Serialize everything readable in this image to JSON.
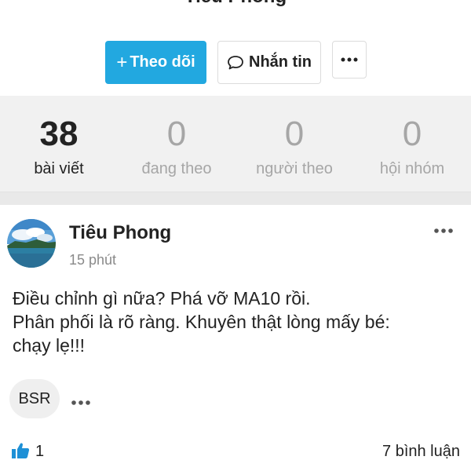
{
  "profile": {
    "name": "Tiêu Phong"
  },
  "actions": {
    "follow_label": "Theo dõi",
    "message_label": "Nhắn tin",
    "more_icon": "more-horizontal-icon"
  },
  "stats": [
    {
      "value": "38",
      "label": "bài viết"
    },
    {
      "value": "0",
      "label": "đang theo"
    },
    {
      "value": "0",
      "label": "người theo"
    },
    {
      "value": "0",
      "label": "hội nhóm"
    }
  ],
  "post": {
    "author": "Tiêu Phong",
    "time": "15 phút",
    "lines": [
      "Điều chỉnh gì nữa? Phá vỡ MA10 rồi.",
      "Phân phối là rõ ràng. Khuyên thật lòng mấy bé:",
      "chạy lẹ!!!"
    ],
    "tag": "BSR",
    "likes": "1",
    "comments": "7 bình luận"
  },
  "colors": {
    "accent": "#22a8e0",
    "like": "#1e90d6",
    "stats_bg": "#f1f1f1",
    "muted": "#a6a6a6"
  }
}
